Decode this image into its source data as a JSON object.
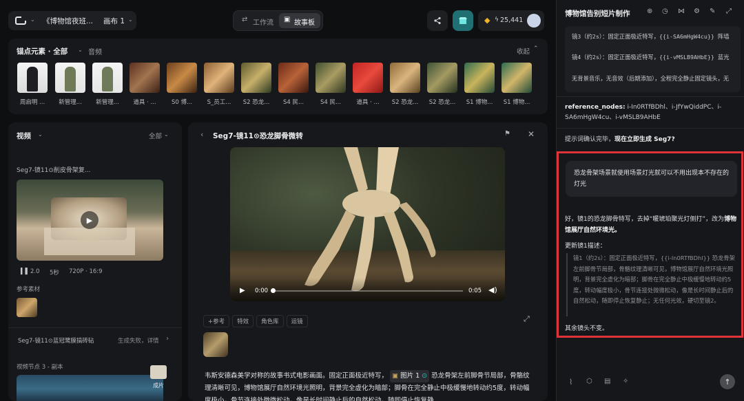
{
  "topbar": {
    "project_title": "《博物馆夜班...",
    "canvas_label": "画布 1",
    "tab_workflow": "工作流",
    "tab_storyboard": "故事板",
    "credits": "25,441"
  },
  "anchor": {
    "title": "锚点元素 · 全部",
    "audio_tab": "音频",
    "collapse": "收起",
    "items": [
      {
        "caption": "周启明 ..."
      },
      {
        "caption": "新管理..."
      },
      {
        "caption": "新管理..."
      },
      {
        "caption": "道具 · ..."
      },
      {
        "caption": "S0 博..."
      },
      {
        "caption": "S_员工..."
      },
      {
        "caption": "S2 恐龙..."
      },
      {
        "caption": "S4 民..."
      },
      {
        "caption": "S4 民..."
      },
      {
        "caption": "道具 · ..."
      },
      {
        "caption": "S2 恐龙..."
      },
      {
        "caption": "S2 恐龙..."
      },
      {
        "caption": "S1 博物..."
      },
      {
        "caption": "S1 博物..."
      }
    ]
  },
  "video_panel": {
    "title": "视频",
    "filter": "全部",
    "clip_title": "Seg7-镜11⊙削皮骨架复...",
    "meta_version": "2.0",
    "meta_duration": "5秒",
    "meta_res": "720P · 16:9",
    "ref_label": "参考素材",
    "fail_item": "Seg7-镜11⊙蓝冠鹭膜搞砖砧",
    "fail_status": "生成失败，详情",
    "node_label": "视频节点 3 - 副本",
    "film_label": "成片"
  },
  "center": {
    "title": "Seg7-镜11⊙恐龙脚骨微转",
    "time_current": "0:00",
    "time_total": "0:05",
    "toolbar": [
      "+参考",
      "特效",
      "角色库",
      "运镜"
    ],
    "prompt_text": "韦斯安德森美学对称的故事书式电影画面。固定正面极近特写，",
    "prompt_chip": "图片 1",
    "prompt_text2": "恐龙骨架左前脚骨节局部，骨骼纹理清晰可见，博物馆展厅自然环境光照明，背景完全虚化为暗部；脚骨在完全静止中极缓慢地转动约5度，转动幅度极小，骨节连接处微微松动，像是长时间静止后的自然松动，随即停止恢复静"
  },
  "chat": {
    "title": "博物馆告别短片制作",
    "code_lines": [
      "镜3（约2s）：固定正面极近特写，{{i-SA6mHgW4cu}} 阵墙",
      "镜4（约2s）：固定正面极近特写，{{i-vMSLB9AHbE}} 蓝光",
      "无背景音乐，无音效（后期添加），全程完全静止固定镜头，无"
    ],
    "ref_nodes_label": "reference_nodes",
    "ref_nodes_value": "i-In0RTfBDhl、i-JfYwQiddPC、i-SA6mHgW4cu、i-vMSLB9AHbE",
    "confirm_prefix": "提示词确认完毕，",
    "confirm_bold": "现在立即生成 Seg7?",
    "user_msg": "恐龙骨架场景就使用场景灯光就可以不用出现本不存在的灯光",
    "reply_prefix": "好，镜1的恐龙脚骨特写，去掉“暖琥珀聚光灯侧打”，改为",
    "reply_bold": "博物馆展厅自然环境光。",
    "update_label": "更新镜1描述：",
    "quote": "镜1（约2s）：固定正面极近特写，{{i-In0RTfBDhl}} 恐龙骨架左前脚骨节局部，骨骼纹理清晰可见，博物馆展厅自然环境光照明，背景完全虚化为暗部；脚骨在完全静止中极缓慢地转动约5度，转动幅度极小，骨节连接处微微松动，像是长时间静止后的自然松动，随即停止恢复静止；无任何光效，硬切至镜2。",
    "tail": "其余镜头不变。"
  },
  "colors": {
    "accent": "#e0343a",
    "teal": "#2ec4b6",
    "gold": "#f0b429",
    "link": "#5b9bff"
  }
}
